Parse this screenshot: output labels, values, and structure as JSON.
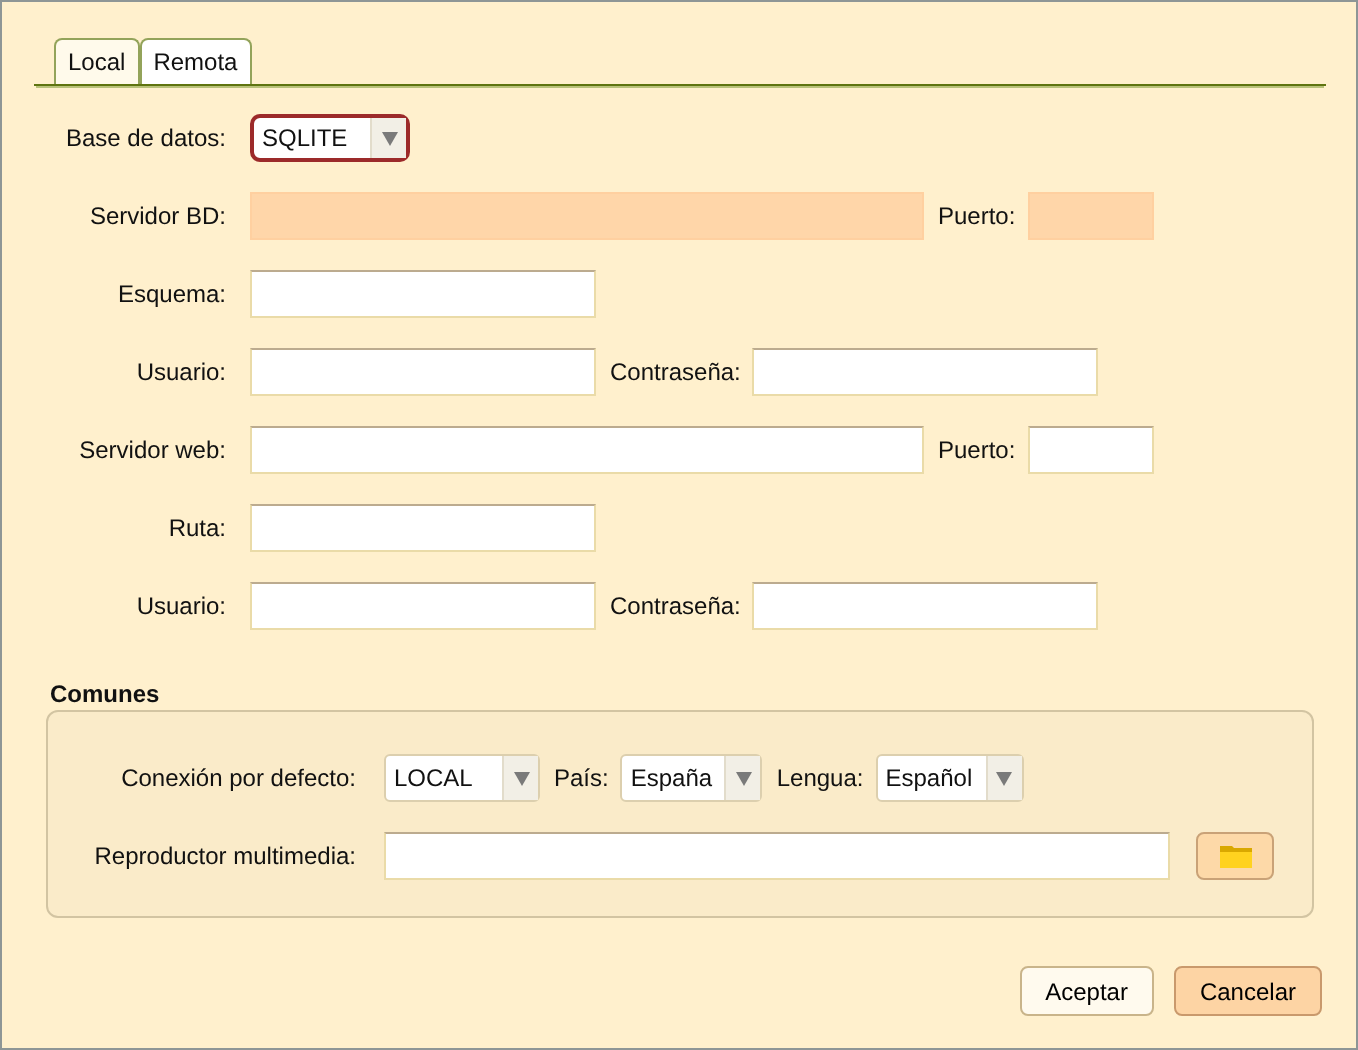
{
  "tabs": [
    {
      "label": "Local",
      "selected": true
    },
    {
      "label": "Remota",
      "selected": false
    }
  ],
  "fields": [
    [
      {
        "label": "Base de datos:",
        "kind": "select",
        "value": "SQLITE",
        "focused": true
      }
    ],
    [
      {
        "label": "Servidor BD:",
        "kind": "input",
        "disabled": true
      },
      {
        "label": "Puerto:",
        "kind": "input",
        "disabled": true
      }
    ],
    [
      {
        "label": "Esquema:",
        "kind": "input",
        "disabled": false
      }
    ],
    [
      {
        "label": "Usuario:",
        "kind": "input",
        "disabled": false
      },
      {
        "label": "Contraseña:",
        "kind": "input",
        "disabled": false
      }
    ],
    [
      {
        "label": "Servidor web:",
        "kind": "input",
        "disabled": false
      },
      {
        "label": "Puerto:",
        "kind": "input",
        "disabled": false
      }
    ],
    [
      {
        "label": "Ruta:",
        "kind": "input",
        "disabled": false
      }
    ],
    [
      {
        "label": "Usuario:",
        "kind": "input",
        "disabled": false
      },
      {
        "label": "Contraseña:",
        "kind": "input",
        "disabled": false
      }
    ]
  ],
  "comunes": {
    "title": "Comunes",
    "rows": [
      [
        {
          "label": "Conexión por defecto:",
          "kind": "select",
          "value": "LOCAL",
          "focused": false
        },
        {
          "label": "País:",
          "kind": "select",
          "value": "España",
          "focused": false
        },
        {
          "label": "Lengua:",
          "kind": "select",
          "value": "Español",
          "focused": false
        }
      ],
      [
        {
          "label": "Reproductor multimedia:",
          "kind": "input",
          "disabled": false
        },
        {
          "kind": "folder_button"
        }
      ]
    ]
  },
  "buttons": [
    {
      "label": "Aceptar",
      "default": false
    },
    {
      "label": "Cancelar",
      "default": true
    }
  ]
}
